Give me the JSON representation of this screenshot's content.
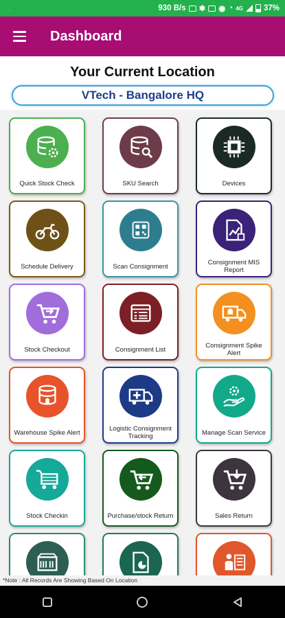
{
  "status_bar": {
    "left_text": "...",
    "speed": "930 B/s",
    "network": "4G",
    "battery": "37%"
  },
  "app_bar": {
    "title": "Dashboard"
  },
  "location": {
    "heading": "Your Current Location",
    "value": "VTech - Bangalore HQ"
  },
  "tiles": [
    {
      "label": "Quick Stock Check",
      "color": "#4caf50",
      "border": "#4caf50",
      "icon": "database-gear-icon"
    },
    {
      "label": "SKU Search",
      "color": "#6d3c4a",
      "border": "#6d3c4a",
      "icon": "database-search-icon"
    },
    {
      "label": "Devices",
      "color": "#1b2a24",
      "border": "#1b2a24",
      "icon": "chip-icon"
    },
    {
      "label": "Schedule Delivery",
      "color": "#6f5118",
      "border": "#7a5a14",
      "icon": "motorbike-icon"
    },
    {
      "label": "Scan Consignment",
      "color": "#2e7d8f",
      "border": "#3b94a6",
      "icon": "qr-scan-icon"
    },
    {
      "label": "Consignment MIS Report",
      "color": "#3a2279",
      "border": "#3a2279",
      "icon": "report-chart-icon"
    },
    {
      "label": "Stock Checkout",
      "color": "#a06ddb",
      "border": "#a06ddb",
      "icon": "cart-out-icon"
    },
    {
      "label": "Consignment List",
      "color": "#7c1f26",
      "border": "#7c1f26",
      "icon": "list-window-icon"
    },
    {
      "label": "Consignment Spike Alert",
      "color": "#f39020",
      "border": "#f39020",
      "icon": "truck-alert-icon"
    },
    {
      "label": "Warehouse Spike Alert",
      "color": "#e8532b",
      "border": "#e8532b",
      "icon": "database-alert-icon"
    },
    {
      "label": "Logistic Consignment Tracking",
      "color": "#1d3a86",
      "border": "#1d3a86",
      "icon": "ambulance-icon"
    },
    {
      "label": "Manage Scan Service",
      "color": "#12a98a",
      "border": "#12a98a",
      "icon": "hand-gear-icon"
    },
    {
      "label": "Stock Checkin",
      "color": "#15a99a",
      "border": "#15a99a",
      "icon": "cart-in-icon"
    },
    {
      "label": "Purchase/stock Return",
      "color": "#145a1c",
      "border": "#145a1c",
      "icon": "cart-return-icon"
    },
    {
      "label": "Sales Return",
      "color": "#3d3440",
      "border": "#3d3440",
      "icon": "cart-down-icon"
    },
    {
      "label": "",
      "color": "#2c5e53",
      "border": "#2c8c73",
      "icon": "scanner-icon"
    },
    {
      "label": "",
      "color": "#1b6650",
      "border": "#1e7a5c",
      "icon": "document-chart-icon"
    },
    {
      "label": "",
      "color": "#e0572c",
      "border": "#e0572c",
      "icon": "person-list-icon"
    }
  ],
  "note": "*Note : All Records Are Showing Based On Location"
}
